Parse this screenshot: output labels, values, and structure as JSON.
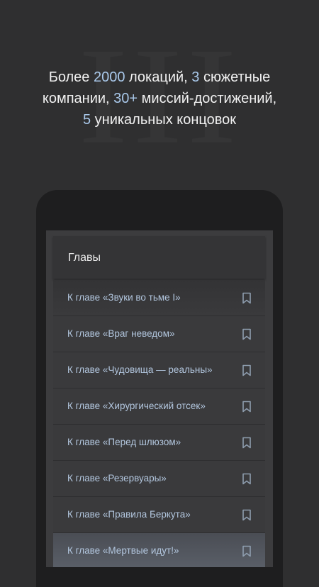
{
  "background": {
    "roman_numeral": "III"
  },
  "headline": {
    "line1": {
      "t1": "Более ",
      "n1": "2000",
      "t2": " локаций, ",
      "n2": "3",
      "t3": " сюжетные"
    },
    "line2": {
      "t1": "компании, ",
      "n1": "30+",
      "t2": " миссий-достижений,"
    },
    "line3": {
      "n1": "5",
      "t1": " уникальных концовок"
    }
  },
  "colors": {
    "highlight": "#a9c8ea",
    "item_text": "#b2c6de",
    "background": "#2f2f30"
  },
  "app": {
    "title": "Главы",
    "chapters": [
      {
        "label": "К главе «Звуки во тьме I»",
        "icon": "bookmark-icon"
      },
      {
        "label": "К главе «Враг неведом»",
        "icon": "bookmark-icon"
      },
      {
        "label": "К главе «Чудовища — реальны»",
        "icon": "bookmark-icon"
      },
      {
        "label": "К главе «Хирургический отсек»",
        "icon": "bookmark-icon"
      },
      {
        "label": "К главе «Перед шлюзом»",
        "icon": "bookmark-icon"
      },
      {
        "label": "К главе «Резервуары»",
        "icon": "bookmark-icon"
      },
      {
        "label": "К главе «Правила Беркута»",
        "icon": "bookmark-icon"
      },
      {
        "label": "К главе «Мертвые идут!»",
        "icon": "bookmark-icon"
      }
    ]
  }
}
